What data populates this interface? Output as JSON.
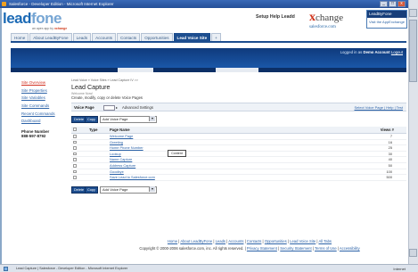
{
  "window": {
    "title": "Salesforce - Developer Edition - Microsoft Internet Explorer",
    "min": "_",
    "max": "□",
    "close": "x"
  },
  "brand": {
    "logo_lead": "lead",
    "logo_fone": "fone",
    "sub_prefix": "an ",
    "sub_app": "apex",
    "sub_mid": " app by ",
    "sub_x": "xchange"
  },
  "header": {
    "help_links": "Setup  Help  Leadd",
    "xchange_x": "x",
    "xchange_text": "change",
    "xchange_sf": "salesforce.com",
    "box_top": "LeadByFone",
    "box_link": "Visit the AppExchange"
  },
  "tabs": [
    "Home",
    "About LeadByFone",
    "Leads",
    "Accounts",
    "Contacts",
    "Opportunities",
    "Lead Voice Site",
    "+"
  ],
  "banner": {
    "logged_prefix": "Logged in as ",
    "user": "Demo Account",
    "logout": "Logout"
  },
  "sidebar": {
    "items": [
      "Site Overview",
      "Site Properties",
      "Site Variables",
      "Site Commands",
      "Recent Commands",
      "Dashboard"
    ],
    "selected_index": 0,
    "phone_label": "Phone Number",
    "phone_value": "888-597-8792"
  },
  "content": {
    "breadcrumb": "Lead Voice » Voice Sites » Lead Capture IV >>",
    "title": "Lead Capture",
    "muted": "Welcome Now!",
    "description": "Create, modify, copy or delete Voice Pages",
    "filter_label": "Voice Page",
    "filter_advanced": "Advanced Settings",
    "filter_right": "Select Voice Page | Help | Test",
    "btn_delete": "Delete",
    "btn_copy": "Copy",
    "dropdown": "Add Voice Page",
    "tooltip": "Content"
  },
  "table": {
    "headers": {
      "type": "Type",
      "name": "Page Name",
      "views": "Views #"
    },
    "rows": [
      {
        "name": "Welcome Page",
        "views": "7"
      },
      {
        "name": "Greeting",
        "views": "16"
      },
      {
        "name": "Home Phone Number",
        "views": "25"
      },
      {
        "name": "Lookup",
        "views": "30"
      },
      {
        "name": "Name Capture",
        "views": "40"
      },
      {
        "name": "Address Capture",
        "views": "50"
      },
      {
        "name": "Goodbye",
        "views": "100"
      },
      {
        "name": "Save Lead to Salesforce.com",
        "views": "500"
      }
    ]
  },
  "footer": {
    "links": [
      "Home",
      "About LeadByFone",
      "Leads",
      "Accounts",
      "Contacts",
      "Opportunities",
      "Lead Voice Site",
      "All Tabs"
    ],
    "copyright": "Copyright © 2000-2006 salesforce.com, inc. All rights reserved.",
    "legal": [
      "Privacy Statement",
      "Security Statement",
      "Terms of Use",
      "Accessibility"
    ]
  },
  "status": {
    "message": "Lead Capture | Salesforce - Developer Edition - Microsoft Internet Explorer",
    "zone": "Internet"
  }
}
